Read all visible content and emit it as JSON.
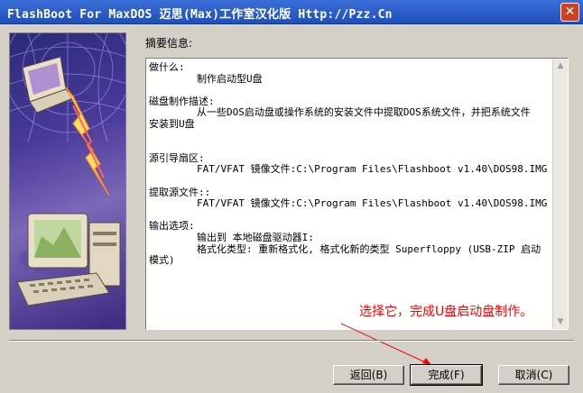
{
  "window": {
    "title": "FlashBoot For MaxDOS 迈思(Max)工作室汉化版 Http://Pzz.Cn",
    "close_symbol": "✕"
  },
  "summary": {
    "label": "摘要信息:",
    "text": "做什么:\n        制作启动型U盘\n\n磁盘制作描述:\n        从一些DOS启动盘或操作系统的安装文件中提取DOS系统文件，并把系统文件\n安装到U盘\n\n\n源引导扇区:\n        FAT/VFAT 镜像文件:C:\\Program Files\\Flashboot v1.40\\DOS98.IMG\n\n提取源文件::\n        FAT/VFAT 镜像文件:C:\\Program Files\\Flashboot v1.40\\DOS98.IMG\n\n输出选项:\n        输出到 本地磁盘驱动器I:\n        格式化类型: 重新格式化, 格式化新的类型 Superfloppy (USB-ZIP 启动\n模式)"
  },
  "annotation": {
    "text": "选择它，完成U盘启动盘制作。",
    "color": "#ff0000"
  },
  "buttons": {
    "back": "返回(B)",
    "finish": "完成(F)",
    "cancel": "取消(C)"
  },
  "colors": {
    "titlebar": "#1f4fb8",
    "window_bg": "#d4d0c8",
    "close_button": "#d04020"
  },
  "icons": [
    "close-icon",
    "computer-illustration-icon",
    "scroll-up-arrow-icon",
    "scroll-down-arrow-icon"
  ]
}
